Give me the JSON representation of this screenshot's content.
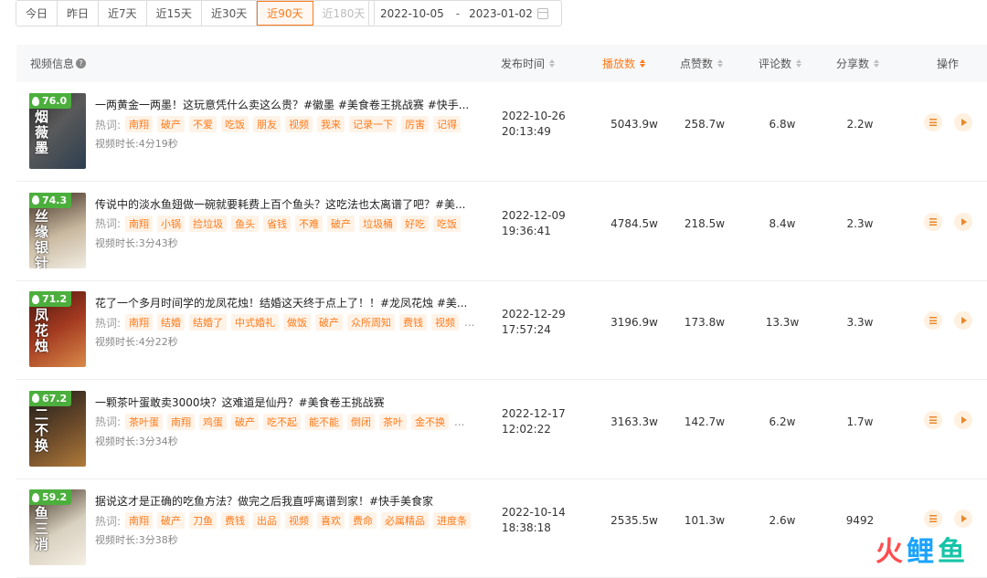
{
  "filters": {
    "ranges": [
      {
        "label": "今日",
        "state": "normal"
      },
      {
        "label": "昨日",
        "state": "normal"
      },
      {
        "label": "近7天",
        "state": "normal"
      },
      {
        "label": "近15天",
        "state": "normal"
      },
      {
        "label": "近30天",
        "state": "normal"
      },
      {
        "label": "近90天",
        "state": "active"
      },
      {
        "label": "近180天",
        "state": "disabled"
      }
    ],
    "date_start": "2022-10-05",
    "date_sep": "-",
    "date_end": "2023-01-02"
  },
  "table": {
    "headers": {
      "video": "视频信息",
      "publish_time": "发布时间",
      "plays": "播放数",
      "likes": "点赞数",
      "comments": "评论数",
      "shares": "分享数",
      "actions": "操作"
    },
    "hot_label": "热词:",
    "duration_label": "视频时长:",
    "rows": [
      {
        "score": "76.0",
        "thumb_text": "烟薇墨",
        "title": "一两黄金一两墨！这玩意凭什么卖这么贵？#徽墨 #美食卷王挑战赛 #快手...",
        "tags": [
          "南翔",
          "破产",
          "不爱",
          "吃饭",
          "朋友",
          "视频",
          "我来",
          "记录一下",
          "厉害",
          "记得"
        ],
        "more": "",
        "duration": "4分19秒",
        "date": "2022-10-26",
        "time": "20:13:49",
        "plays": "5043.9w",
        "likes": "258.7w",
        "comments": "6.8w",
        "shares": "2.2w"
      },
      {
        "score": "74.3",
        "thumb_text": "丝缘银针",
        "title": "传说中的淡水鱼翅做一碗就要耗费上百个鱼头？这吃法也太离谱了吧？#美...",
        "tags": [
          "南翔",
          "小锅",
          "捡垃圾",
          "鱼头",
          "省钱",
          "不难",
          "破产",
          "垃圾桶",
          "好吃",
          "吃饭"
        ],
        "more": "",
        "duration": "3分43秒",
        "date": "2022-12-09",
        "time": "19:36:41",
        "plays": "4784.5w",
        "likes": "218.5w",
        "comments": "8.4w",
        "shares": "2.3w"
      },
      {
        "score": "71.2",
        "thumb_text": "凤花烛",
        "title": "花了一个多月时间学的龙凤花烛！结婚这天终于点上了！！#龙凤花烛 #美...",
        "tags": [
          "南翔",
          "结婚",
          "结婚了",
          "中式婚礼",
          "做饭",
          "破产",
          "众所周知",
          "费钱",
          "视频"
        ],
        "more": "...",
        "duration": "4分22秒",
        "date": "2022-12-29",
        "time": "17:57:24",
        "plays": "3196.9w",
        "likes": "173.8w",
        "comments": "13.3w",
        "shares": "3.3w"
      },
      {
        "score": "67.2",
        "thumb_text": "二不换",
        "title": "一颗茶叶蛋敢卖3000块？这难道是仙丹？#美食卷王挑战赛",
        "tags": [
          "茶叶蛋",
          "南翔",
          "鸡蛋",
          "破产",
          "吃不起",
          "能不能",
          "倒闭",
          "茶叶",
          "金不换"
        ],
        "more": "...",
        "duration": "3分34秒",
        "date": "2022-12-17",
        "time": "12:02:22",
        "plays": "3163.3w",
        "likes": "142.7w",
        "comments": "6.2w",
        "shares": "1.7w"
      },
      {
        "score": "59.2",
        "thumb_text": "鱼三消",
        "title": "据说这才是正确的吃鱼方法？做完之后我直呼离谱到家！#快手美食家",
        "tags": [
          "南翔",
          "破产",
          "刀鱼",
          "费钱",
          "出品",
          "视频",
          "喜欢",
          "费命",
          "必属精品",
          "进度条"
        ],
        "more": "",
        "duration": "3分38秒",
        "date": "2022-10-14",
        "time": "18:38:18",
        "plays": "2535.5w",
        "likes": "101.3w",
        "comments": "2.6w",
        "shares": "9492"
      }
    ]
  },
  "watermark": {
    "chars": [
      "火",
      "鲤",
      "鱼"
    ],
    "colors": [
      "#ff4d4f",
      "#1aa3ff",
      "#17c4a8"
    ]
  },
  "colors": {
    "accent": "#ff7a1a",
    "score_badge": "#4caf3d"
  }
}
